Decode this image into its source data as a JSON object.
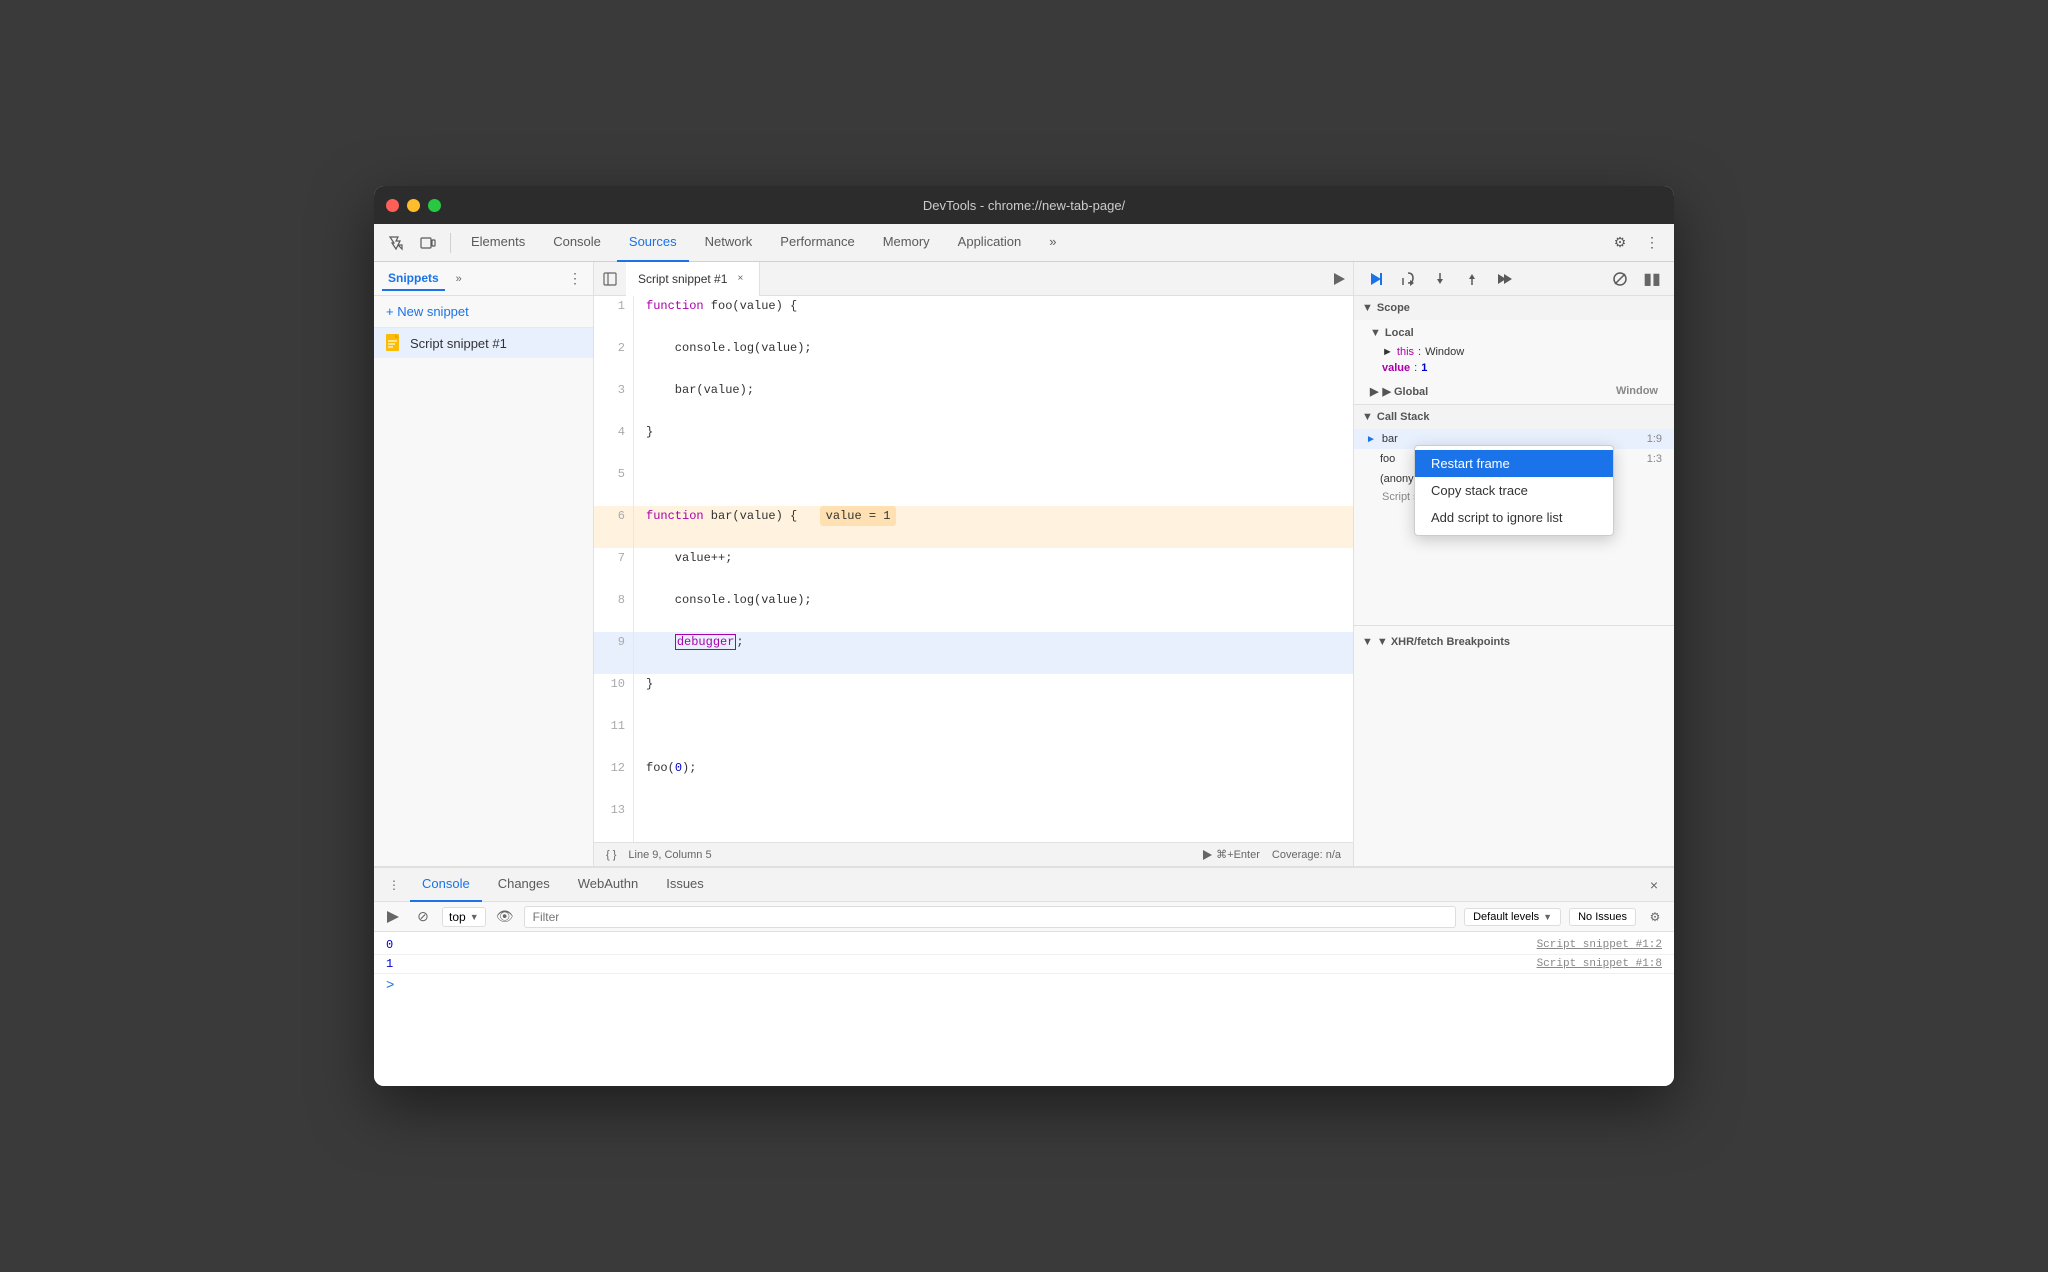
{
  "window": {
    "title": "DevTools - chrome://new-tab-page/"
  },
  "traffic_lights": {
    "red": "close",
    "yellow": "minimize",
    "green": "maximize"
  },
  "top_tabs": [
    {
      "label": "Elements",
      "active": false
    },
    {
      "label": "Console",
      "active": false
    },
    {
      "label": "Sources",
      "active": true
    },
    {
      "label": "Network",
      "active": false
    },
    {
      "label": "Performance",
      "active": false
    },
    {
      "label": "Memory",
      "active": false
    },
    {
      "label": "Application",
      "active": false
    }
  ],
  "sidebar": {
    "tab_label": "Snippets",
    "new_snippet_label": "+ New snippet",
    "snippet_item_label": "Script snippet #1"
  },
  "code_tab": {
    "label": "Script snippet #1"
  },
  "code_lines": [
    {
      "num": "1",
      "content": "function foo(value) {",
      "type": "normal"
    },
    {
      "num": "2",
      "content": "    console.log(value);",
      "type": "normal"
    },
    {
      "num": "3",
      "content": "    bar(value);",
      "type": "normal"
    },
    {
      "num": "4",
      "content": "}",
      "type": "normal"
    },
    {
      "num": "5",
      "content": "",
      "type": "normal"
    },
    {
      "num": "6",
      "content": "function bar(value) {",
      "type": "debug_highlight",
      "badge": "value = 1"
    },
    {
      "num": "7",
      "content": "    value++;",
      "type": "normal"
    },
    {
      "num": "8",
      "content": "    console.log(value);",
      "type": "normal"
    },
    {
      "num": "9",
      "content": "    debugger;",
      "type": "debugger_active"
    },
    {
      "num": "10",
      "content": "}",
      "type": "normal"
    },
    {
      "num": "11",
      "content": "",
      "type": "normal"
    },
    {
      "num": "12",
      "content": "foo(0);",
      "type": "normal"
    },
    {
      "num": "13",
      "content": "",
      "type": "normal"
    }
  ],
  "status_bar": {
    "format_btn": "{ }",
    "position": "Line 9, Column 5",
    "run_label": "⌘+Enter",
    "coverage": "Coverage: n/a"
  },
  "right_panel": {
    "scope_header": "▼ Scope",
    "local_header": "▼ Local",
    "this_label": "this",
    "this_value": "Window",
    "value_label": "value",
    "value_val": "1",
    "global_header": "▶ Global",
    "global_value": "Window",
    "call_stack_header": "▼ Call Stack",
    "call_stack_items": [
      {
        "name": "bar",
        "loc": "1:9",
        "active": true
      },
      {
        "name": "foo",
        "loc": "1:3",
        "active": false
      },
      {
        "name": "(anonymous)",
        "loc": "",
        "active": false
      }
    ],
    "anon_label": "Script snippet #1:12",
    "xhr_header": "▼ XHR/fetch Breakpoints"
  },
  "context_menu": {
    "items": [
      {
        "label": "Restart frame",
        "highlighted": true
      },
      {
        "label": "Copy stack trace",
        "highlighted": false
      },
      {
        "label": "Add script to ignore list",
        "highlighted": false
      }
    ]
  },
  "console": {
    "tabs": [
      {
        "label": "Console",
        "active": true
      },
      {
        "label": "Changes",
        "active": false
      },
      {
        "label": "WebAuthn",
        "active": false
      },
      {
        "label": "Issues",
        "active": false
      }
    ],
    "top_label": "top",
    "filter_placeholder": "Filter",
    "levels_label": "Default levels",
    "no_issues_label": "No Issues",
    "output_lines": [
      {
        "value": "0",
        "source": "Script snippet #1:2"
      },
      {
        "value": "1",
        "source": "Script snippet #1:8"
      }
    ],
    "prompt": ">"
  }
}
